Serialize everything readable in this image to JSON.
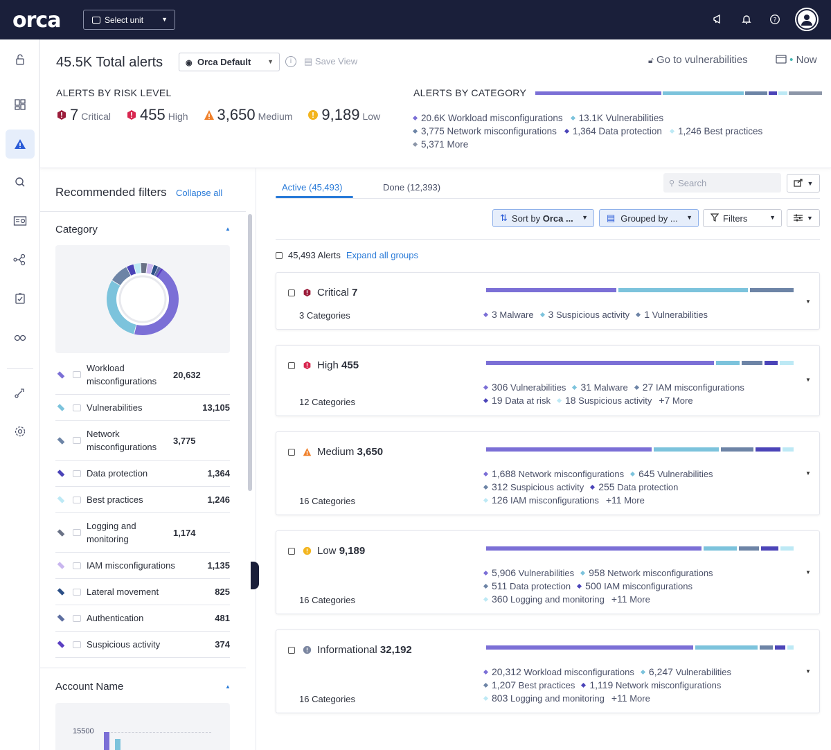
{
  "topbar": {
    "logo": "orca",
    "unit_select": "Select unit",
    "icons": [
      "megaphone-icon",
      "bell-icon",
      "help-icon",
      "user-avatar-icon"
    ]
  },
  "rail": {
    "items": [
      "lock-icon",
      "dashboard-icon",
      "alerts-icon",
      "search-icon",
      "inventory-icon",
      "graph-icon",
      "compliance-icon",
      "shift-left-icon",
      "integrations-icon",
      "settings-icon"
    ],
    "active": "alerts-icon"
  },
  "header": {
    "total": "45.5K Total alerts",
    "view": "Orca Default",
    "save_view": "Save View",
    "goto_vuln": "Go to vulnerabilities",
    "now": "Now",
    "risk_title": "ALERTS BY RISK LEVEL",
    "risk": [
      {
        "num": "7",
        "label": "Critical",
        "color": "#9b1c3a"
      },
      {
        "num": "455",
        "label": "High",
        "color": "#d8264f"
      },
      {
        "num": "3,650",
        "label": "Medium",
        "color": "#f0802a"
      },
      {
        "num": "9,189",
        "label": "Low",
        "color": "#f3b51f"
      }
    ],
    "cat_title": "ALERTS BY CATEGORY",
    "cat_bar": [
      {
        "color": "#7b6fd6",
        "value": 45
      },
      {
        "color": "#7cc3dc",
        "value": 29
      },
      {
        "color": "#6d84a6",
        "value": 8
      },
      {
        "color": "#4b44b8",
        "value": 3
      },
      {
        "color": "#bde9f5",
        "value": 3
      },
      {
        "color": "#8c96a8",
        "value": 12
      }
    ],
    "categories": [
      {
        "text": "20.6K Workload misconfigurations",
        "color": "#7b6fd6"
      },
      {
        "text": "13.1K Vulnerabilities",
        "color": "#7cc3dc"
      },
      {
        "text": "3,775 Network misconfigurations",
        "color": "#6d84a6"
      },
      {
        "text": "1,364 Data protection",
        "color": "#4b44b8"
      },
      {
        "text": "1,246 Best practices",
        "color": "#bde9f5"
      },
      {
        "text": "5,371 More",
        "color": "#8c96a8"
      }
    ]
  },
  "filters": {
    "title": "Recommended filters",
    "collapse_all": "Collapse all",
    "category_label": "Category",
    "rows": [
      {
        "name": "Workload misconfigurations",
        "count": "20,632",
        "color": "#7b6fd6"
      },
      {
        "name": "Vulnerabilities",
        "count": "13,105",
        "color": "#7cc3dc"
      },
      {
        "name": "Network misconfigurations",
        "count": "3,775",
        "color": "#6d84a6"
      },
      {
        "name": "Data protection",
        "count": "1,364",
        "color": "#4b44b8"
      },
      {
        "name": "Best practices",
        "count": "1,246",
        "color": "#bde9f5"
      },
      {
        "name": "Logging and monitoring",
        "count": "1,174",
        "color": "#6a7286"
      },
      {
        "name": "IAM misconfigurations",
        "count": "1,135",
        "color": "#c9b6ef"
      },
      {
        "name": "Lateral movement",
        "count": "825",
        "color": "#2c4f86"
      },
      {
        "name": "Authentication",
        "count": "481",
        "color": "#5d6ea0"
      },
      {
        "name": "Suspicious activity",
        "count": "374",
        "color": "#5b3fc2"
      }
    ],
    "account_label": "Account Name",
    "account_tick": "15500"
  },
  "main": {
    "tab_active": "Active (45,493)",
    "tab_done": "Done (12,393)",
    "search_placeholder": "Search",
    "sort_prefix": "Sort by",
    "sort_value": "Orca ...",
    "group_label": "Grouped by ...",
    "filters_label": "Filters",
    "alerts_count": "45,493 Alerts",
    "expand_all": "Expand all groups"
  },
  "groups": [
    {
      "label": "Critical",
      "count": "7",
      "categories": "3 Categories",
      "color": "#9b1c3a",
      "bar": [
        {
          "color": "#7b6fd6",
          "value": 42
        },
        {
          "color": "#7cc3dc",
          "value": 42
        },
        {
          "color": "#6d84a6",
          "value": 14
        }
      ],
      "items": [
        {
          "n": "3",
          "t": "Malware",
          "color": "#7b6fd6"
        },
        {
          "n": "3",
          "t": "Suspicious activity",
          "color": "#7cc3dc"
        },
        {
          "n": "1",
          "t": "Vulnerabilities",
          "color": "#6d84a6"
        }
      ]
    },
    {
      "label": "High",
      "count": "455",
      "categories": "12 Categories",
      "color": "#d8264f",
      "bar": [
        {
          "color": "#7b6fd6",
          "value": 67
        },
        {
          "color": "#7cc3dc",
          "value": 7
        },
        {
          "color": "#6d84a6",
          "value": 6
        },
        {
          "color": "#4b44b8",
          "value": 4
        },
        {
          "color": "#bde9f5",
          "value": 4
        }
      ],
      "items": [
        {
          "n": "306",
          "t": "Vulnerabilities",
          "color": "#7b6fd6"
        },
        {
          "n": "31",
          "t": "Malware",
          "color": "#7cc3dc"
        },
        {
          "n": "27",
          "t": "IAM misconfigurations",
          "color": "#6d84a6"
        },
        {
          "n": "19",
          "t": "Data at risk",
          "color": "#4b44b8"
        },
        {
          "n": "18",
          "t": "Suspicious activity",
          "color": "#bde9f5"
        },
        {
          "n": "+7",
          "t": "More",
          "color": ""
        }
      ]
    },
    {
      "label": "Medium",
      "count": "3,650",
      "categories": "16 Categories",
      "color": "#f0802a",
      "bar": [
        {
          "color": "#7b6fd6",
          "value": 46
        },
        {
          "color": "#7cc3dc",
          "value": 18
        },
        {
          "color": "#6d84a6",
          "value": 9
        },
        {
          "color": "#4b44b8",
          "value": 7
        },
        {
          "color": "#bde9f5",
          "value": 3
        }
      ],
      "items": [
        {
          "n": "1,688",
          "t": "Network misconfigurations",
          "color": "#7b6fd6"
        },
        {
          "n": "645",
          "t": "Vulnerabilities",
          "color": "#7cc3dc"
        },
        {
          "n": "312",
          "t": "Suspicious activity",
          "color": "#6d84a6"
        },
        {
          "n": "255",
          "t": "Data protection",
          "color": "#4b44b8"
        },
        {
          "n": "126",
          "t": "IAM misconfigurations",
          "color": "#bde9f5"
        },
        {
          "n": "+11",
          "t": "More",
          "color": ""
        }
      ]
    },
    {
      "label": "Low",
      "count": "9,189",
      "categories": "16 Categories",
      "color": "#f3b51f",
      "bar": [
        {
          "color": "#7b6fd6",
          "value": 64
        },
        {
          "color": "#7cc3dc",
          "value": 10
        },
        {
          "color": "#6d84a6",
          "value": 6
        },
        {
          "color": "#4b44b8",
          "value": 5
        },
        {
          "color": "#bde9f5",
          "value": 4
        }
      ],
      "items": [
        {
          "n": "5,906",
          "t": "Vulnerabilities",
          "color": "#7b6fd6"
        },
        {
          "n": "958",
          "t": "Network misconfigurations",
          "color": "#7cc3dc"
        },
        {
          "n": "511",
          "t": "Data protection",
          "color": "#6d84a6"
        },
        {
          "n": "500",
          "t": "IAM misconfigurations",
          "color": "#4b44b8"
        },
        {
          "n": "360",
          "t": "Logging and monitoring",
          "color": "#bde9f5"
        },
        {
          "n": "+11",
          "t": "More",
          "color": ""
        }
      ]
    },
    {
      "label": "Informational",
      "count": "32,192",
      "categories": "16 Categories",
      "color": "#7b86a0",
      "bar": [
        {
          "color": "#7b6fd6",
          "value": 63
        },
        {
          "color": "#7cc3dc",
          "value": 19
        },
        {
          "color": "#6d84a6",
          "value": 4
        },
        {
          "color": "#4b44b8",
          "value": 3
        },
        {
          "color": "#bde9f5",
          "value": 2
        }
      ],
      "items": [
        {
          "n": "20,312",
          "t": "Workload misconfigurations",
          "color": "#7b6fd6"
        },
        {
          "n": "6,247",
          "t": "Vulnerabilities",
          "color": "#7cc3dc"
        },
        {
          "n": "1,207",
          "t": "Best practices",
          "color": "#6d84a6"
        },
        {
          "n": "1,119",
          "t": "Network misconfigurations",
          "color": "#4b44b8"
        },
        {
          "n": "803",
          "t": "Logging and monitoring",
          "color": "#bde9f5"
        },
        {
          "n": "+11",
          "t": "More",
          "color": ""
        }
      ]
    }
  ]
}
